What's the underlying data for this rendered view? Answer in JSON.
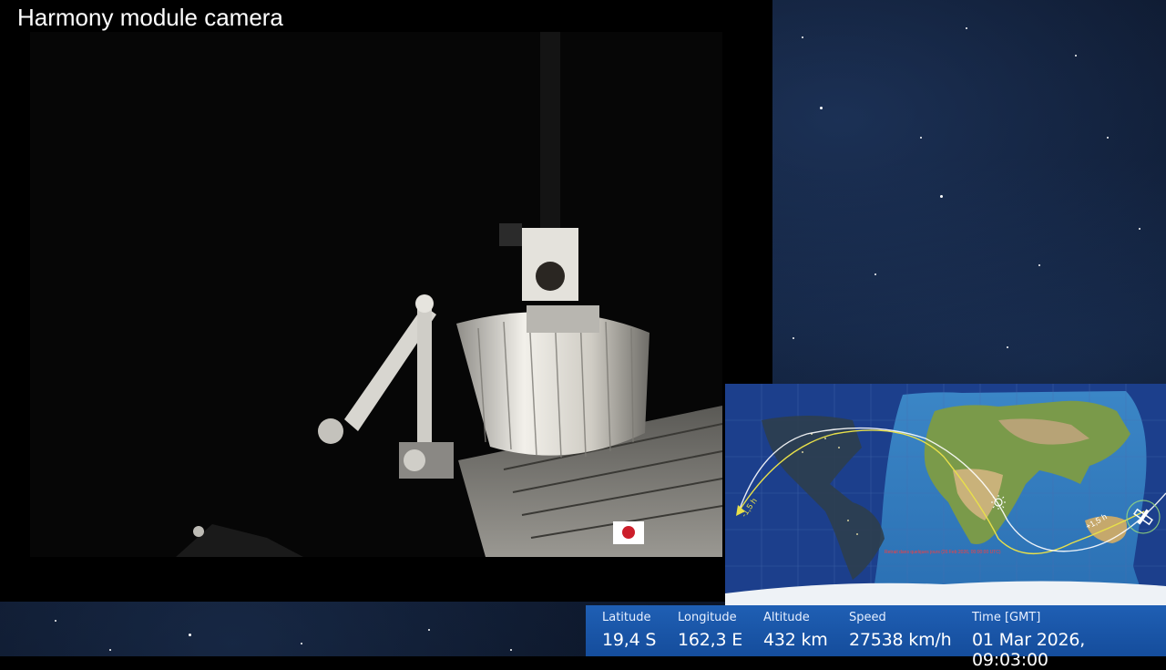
{
  "camera": {
    "title": "Harmony module camera",
    "flag_icon": "japan-flag-icon"
  },
  "map": {
    "track_labels": [
      "-1,5 h",
      "+1,5 h"
    ],
    "notice": "Retrait dans quelques jours (26 Feb 2026, 00:00:00 UTC)",
    "icons": [
      "sun-icon",
      "satellite-icon"
    ],
    "colors": {
      "ocean": "#1c3f8c",
      "day_ocean": "#2a72b8",
      "past_track": "#e8e04a",
      "future_track": "#ffffff",
      "notice": "#ff3b3b"
    }
  },
  "telemetry": {
    "latitude": {
      "label": "Latitude",
      "value": "19,4 S"
    },
    "longitude": {
      "label": "Longitude",
      "value": "162,3 E"
    },
    "altitude": {
      "label": "Altitude",
      "value": "432 km"
    },
    "speed": {
      "label": "Speed",
      "value": "27538 km/h"
    },
    "time": {
      "label": "Time [GMT]",
      "value": "01 Mar 2026, 09:03:00"
    }
  }
}
